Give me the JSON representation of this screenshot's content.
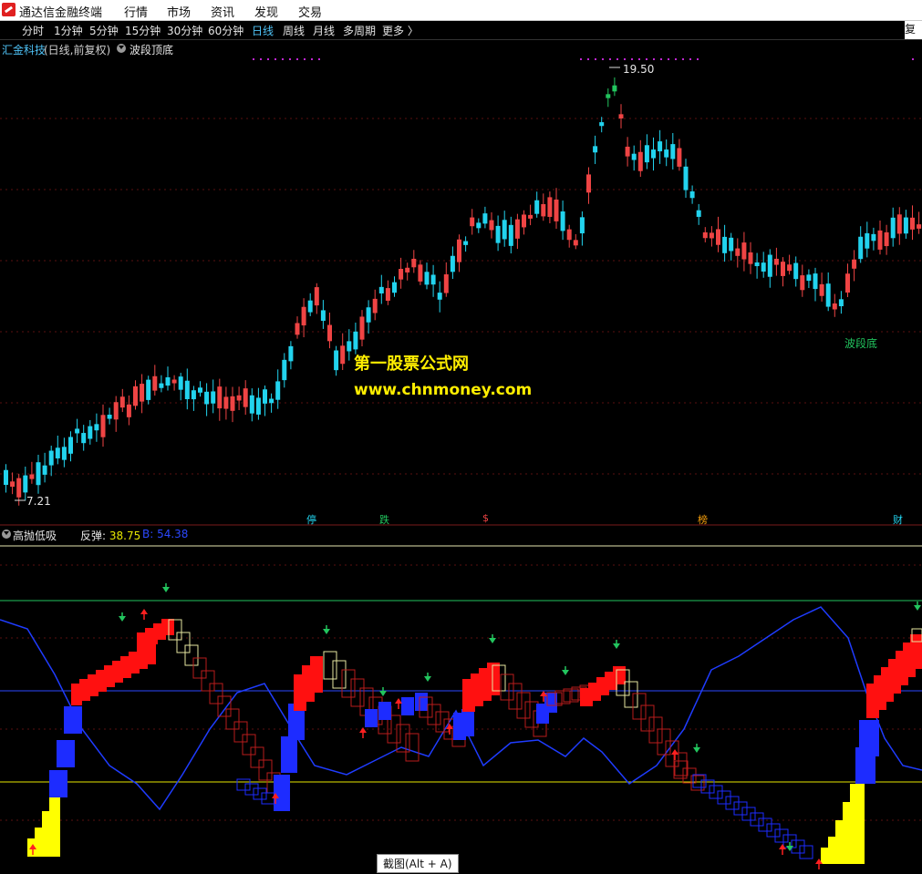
{
  "app": {
    "title": "通达信金融终端",
    "menu": [
      "行情",
      "市场",
      "资讯",
      "发现",
      "交易"
    ]
  },
  "toolbar": {
    "periods": [
      "分时",
      "1分钟",
      "5分钟",
      "15分钟",
      "30分钟",
      "60分钟",
      "日线",
      "周线",
      "月线",
      "多周期",
      "更多 〉"
    ],
    "active_period": "日线",
    "restore_label": "复权"
  },
  "chart": {
    "stock_name": "汇金科技",
    "mode": "(日线,前复权)",
    "indicator": "波段顶底",
    "high_label": "19.50",
    "low_label": "7.21",
    "bottom_label": "波段底",
    "events": [
      "停",
      "跌",
      "$",
      "榜",
      "财"
    ]
  },
  "sub_chart": {
    "name": "高抛低吸",
    "rebound_label": "反弹:",
    "rebound_value": "38.75",
    "b_label": "B: 54.38"
  },
  "watermark": {
    "line1": "第一股票公式网",
    "line2": "www.chnmoney.com"
  },
  "tooltip": "截图(Alt + A)",
  "colors": {
    "up": "#ef4444",
    "down": "#22d3ee",
    "line_blue": "#1f3cff",
    "yellow": "#ffff00",
    "green": "#22c55e"
  }
}
